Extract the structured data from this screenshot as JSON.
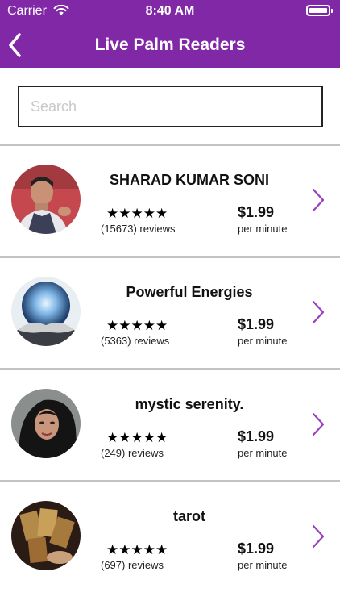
{
  "status_bar": {
    "carrier": "Carrier",
    "time": "8:40 AM"
  },
  "nav": {
    "title": "Live Palm Readers",
    "back_icon": "chevron-left-icon"
  },
  "search": {
    "placeholder": "Search",
    "value": ""
  },
  "readers": [
    {
      "name": "SHARAD KUMAR SONI",
      "stars": "★★★★★",
      "reviews": "(15673) reviews",
      "price": "$1.99",
      "unit": "per minute"
    },
    {
      "name": "Powerful Energies",
      "stars": "★★★★★",
      "reviews": "(5363) reviews",
      "price": "$1.99",
      "unit": "per minute"
    },
    {
      "name": "mystic serenity.",
      "stars": "★★★★★",
      "reviews": "(249) reviews",
      "price": "$1.99",
      "unit": "per minute"
    },
    {
      "name": "tarot",
      "stars": "★★★★★",
      "reviews": "(697) reviews",
      "price": "$1.99",
      "unit": "per minute"
    }
  ],
  "colors": {
    "accent": "#8128a7",
    "chevron": "#9a3fc0",
    "divider": "#c3c3c3"
  }
}
